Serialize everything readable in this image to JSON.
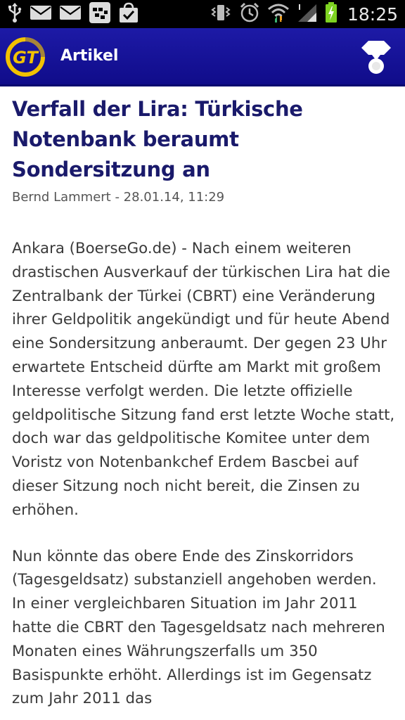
{
  "status_bar": {
    "time": "18:25",
    "icons_left": [
      "usb-icon",
      "mail-icon",
      "mail-icon",
      "bbm-icon",
      "shopping-bag-icon"
    ],
    "icons_right": [
      "vibrate-icon",
      "alarm-icon",
      "wifi-icon",
      "signal-icon",
      "battery-charging-icon"
    ]
  },
  "action_bar": {
    "logo_text": "GT",
    "title": "Artikel",
    "action_icon": "share-icon"
  },
  "article": {
    "headline": "Verfall der Lira: Türkische Notenbank beraumt Sondersitzung an",
    "byline": "Bernd Lammert - 28.01.14, 11:29",
    "paragraphs": [
      "Ankara (BoerseGo.de) - Nach einem weiteren drastischen Ausverkauf der türkischen Lira hat die Zentralbank der Türkei (CBRT) eine Veränderung ihrer Geldpolitik angekündigt und für heute Abend eine Sondersitzung anberaumt. Der gegen 23 Uhr erwartete Entscheid dürfte am Markt mit großem Interesse verfolgt werden. Die letzte offizielle geldpolitische Sitzung fand erst letzte Woche statt, doch war das geldpolitische Komitee unter dem Voristz von Notenbankchef Erdem Bascbei auf dieser Sitzung noch nicht bereit, die Zinsen zu erhöhen.",
      "Nun könnte das obere Ende des Zinskorridors (Tagesgeldsatz) substanziell angehoben werden. In einer vergleichbaren Situation im Jahr 2011 hatte die CBRT den Tagesgeldsatz nach mehreren Monaten eines Währungszerfalls um 350 Basispunkte erhöht. Allerdings ist im Gegensatz zum Jahr 2011 das"
    ]
  },
  "colors": {
    "action_bar": "#1713a0",
    "logo": "#f2c200",
    "headline": "#1a1a6b",
    "body_text": "#3a3a3a",
    "battery": "#7ed321"
  }
}
